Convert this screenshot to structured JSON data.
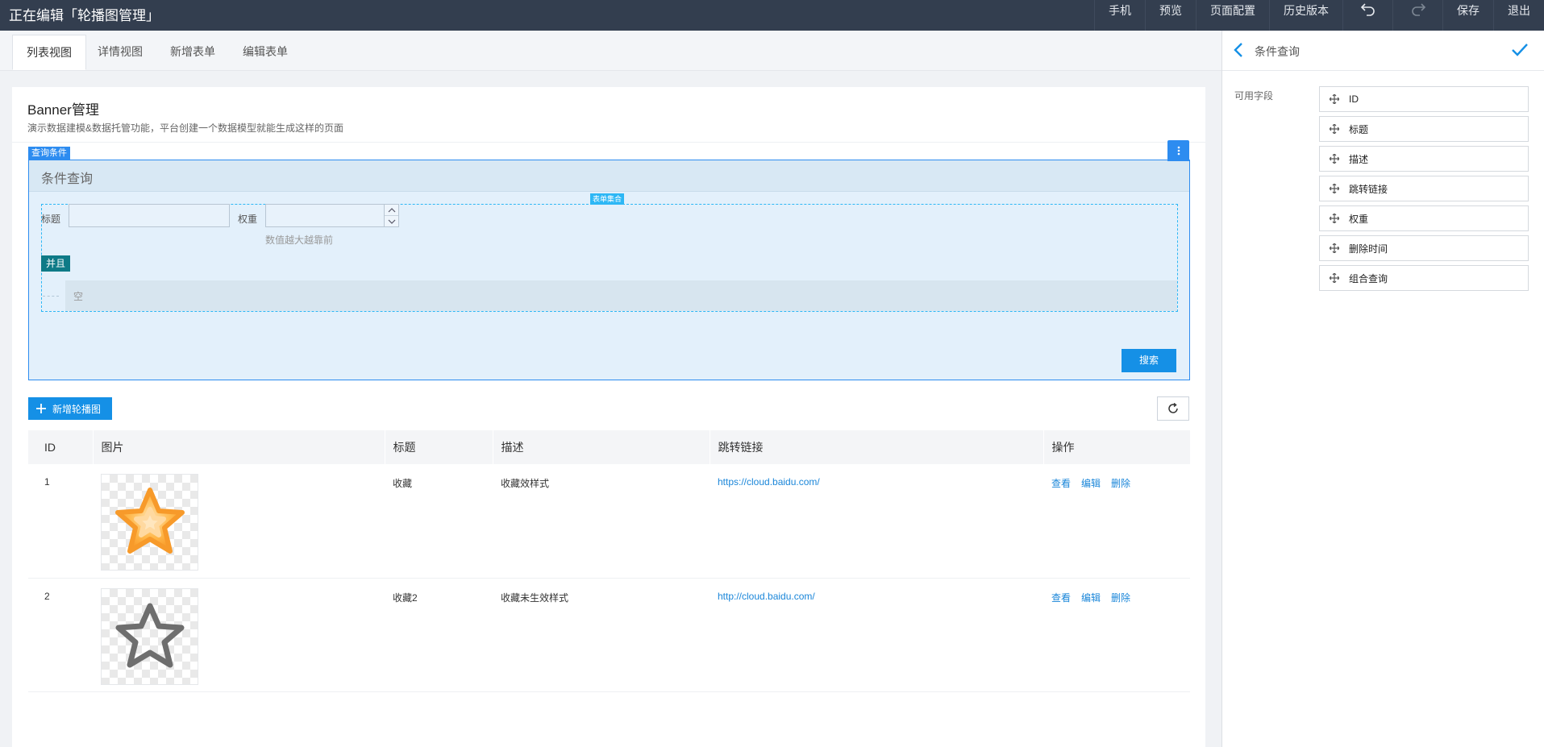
{
  "topbar": {
    "title": "正在编辑「轮播图管理」",
    "actions": {
      "mobile": "手机",
      "preview": "预览",
      "page_config": "页面配置",
      "history": "历史版本",
      "save": "保存",
      "exit": "退出"
    }
  },
  "tabs": [
    {
      "label": "列表视图",
      "active": true
    },
    {
      "label": "详情视图"
    },
    {
      "label": "新增表单"
    },
    {
      "label": "编辑表单"
    }
  ],
  "page": {
    "title": "Banner管理",
    "description": "演示数据建模&数据托管功能，平台创建一个数据模型就能生成这样的页面"
  },
  "query": {
    "tag": "查询条件",
    "heading": "条件查询",
    "formset_tag": "表单集合",
    "fields": {
      "title_label": "标题",
      "weight_label": "权重",
      "weight_hint": "数值越大越靠前"
    },
    "and_label": "并且",
    "empty_label": "空",
    "search_label": "搜索"
  },
  "toolbar": {
    "add_label": "新增轮播图"
  },
  "table": {
    "columns": [
      "ID",
      "图片",
      "标题",
      "描述",
      "跳转链接",
      "操作"
    ],
    "rows": [
      {
        "id": "1",
        "image": "star-filled-icon",
        "title": "收藏",
        "desc": "收藏效样式",
        "url": "https://cloud.baidu.com/"
      },
      {
        "id": "2",
        "image": "star-outline-icon",
        "title": "收藏2",
        "desc": "收藏未生效样式",
        "url": "http://cloud.baidu.com/"
      }
    ],
    "ops": {
      "view": "查看",
      "edit": "编辑",
      "delete": "删除"
    }
  },
  "panel": {
    "title": "条件查询",
    "fields_label": "可用字段",
    "fields": [
      "ID",
      "标题",
      "描述",
      "跳转链接",
      "权重",
      "删除时间",
      "组合查询"
    ]
  },
  "colors": {
    "topbar": "#333e4f",
    "primary": "#1590e6",
    "query_bg": "#e3f0fb",
    "and_btn": "#0e7a87"
  }
}
